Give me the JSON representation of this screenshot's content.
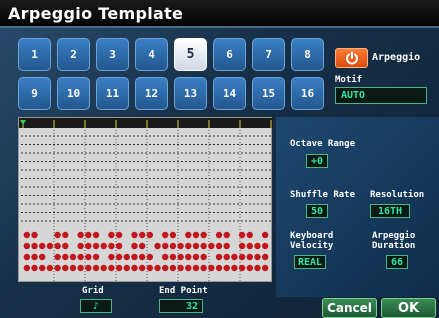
{
  "title": "Arpeggio Template",
  "pads": {
    "items": [
      "1",
      "2",
      "3",
      "4",
      "5",
      "6",
      "7",
      "8",
      "9",
      "10",
      "11",
      "12",
      "13",
      "14",
      "15",
      "16"
    ],
    "selected_index": 4
  },
  "arpeggio": {
    "label": "Arpeggio",
    "icon": "power-icon",
    "on": true
  },
  "motif": {
    "label": "Motif",
    "value": "AUTO"
  },
  "right_panel": {
    "octave_range": {
      "label": "Octave Range",
      "value": "+0"
    },
    "shuffle_rate": {
      "label": "Shuffle Rate",
      "value": "50"
    },
    "resolution": {
      "label": "Resolution",
      "value": "16TH"
    },
    "keyboard_velocity": {
      "label1": "Keyboard",
      "label2": "Velocity",
      "value": "REAL"
    },
    "arpeggio_duration": {
      "label1": "Arpeggio",
      "label2": "Duration",
      "value": "66"
    }
  },
  "bottom": {
    "grid": {
      "label": "Grid",
      "value": "♪"
    },
    "end_point": {
      "label": "End Point",
      "value": "32"
    }
  },
  "buttons": {
    "cancel": "Cancel",
    "ok": "OK"
  },
  "colors": {
    "pad": "#2f6fb0",
    "pad_active": "#e8eef6",
    "arp_orange": "#e85a16",
    "field_text": "#2fe6a0",
    "note_red": "#c2161a",
    "grid_bg": "#d6d6d6"
  },
  "note_columns": [
    [
      1,
      1,
      1,
      1
    ],
    [
      1,
      1,
      1,
      1
    ],
    [
      0,
      1,
      1,
      1
    ],
    [
      0,
      1,
      0,
      1
    ],
    [
      1,
      1,
      1,
      1
    ],
    [
      1,
      1,
      1,
      1
    ],
    [
      0,
      0,
      1,
      1
    ],
    [
      1,
      1,
      1,
      1
    ],
    [
      1,
      1,
      1,
      1
    ],
    [
      1,
      1,
      1,
      1
    ],
    [
      0,
      1,
      0,
      1
    ],
    [
      1,
      1,
      1,
      1
    ],
    [
      1,
      1,
      1,
      1
    ],
    [
      0,
      0,
      1,
      1
    ],
    [
      1,
      1,
      1,
      1
    ],
    [
      1,
      1,
      1,
      1
    ],
    [
      1,
      0,
      1,
      1
    ],
    [
      0,
      1,
      0,
      1
    ],
    [
      1,
      1,
      1,
      1
    ],
    [
      1,
      1,
      1,
      1
    ],
    [
      0,
      1,
      1,
      1
    ],
    [
      1,
      1,
      1,
      1
    ],
    [
      1,
      1,
      1,
      1
    ],
    [
      1,
      1,
      1,
      1
    ],
    [
      0,
      1,
      0,
      1
    ],
    [
      1,
      1,
      1,
      1
    ],
    [
      1,
      1,
      1,
      1
    ],
    [
      0,
      0,
      1,
      1
    ],
    [
      1,
      1,
      1,
      1
    ],
    [
      1,
      1,
      1,
      1
    ],
    [
      0,
      1,
      1,
      1
    ],
    [
      1,
      1,
      1,
      1
    ]
  ]
}
